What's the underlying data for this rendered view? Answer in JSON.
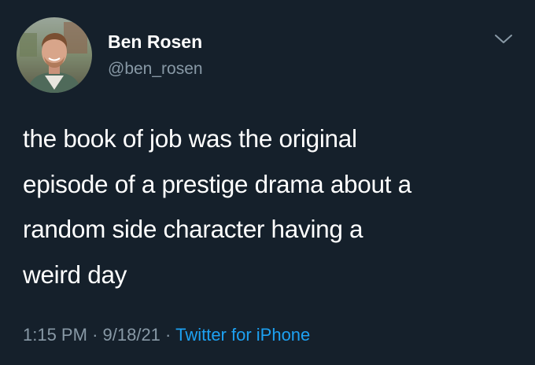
{
  "author": {
    "name": "Ben Rosen",
    "handle": "@ben_rosen"
  },
  "tweet": {
    "lines": [
      "the book of job was the original",
      "episode of a prestige drama about a",
      "random side character having a",
      "weird day"
    ]
  },
  "meta": {
    "time": "1:15 PM",
    "separator": "·",
    "date": "9/18/21",
    "source": "Twitter for iPhone"
  },
  "icons": {
    "more": "chevron-down-icon",
    "avatar": "avatar"
  },
  "colors": {
    "background": "#15202b",
    "text": "#ffffff",
    "secondary": "#8899a6",
    "link": "#1da1f2"
  }
}
